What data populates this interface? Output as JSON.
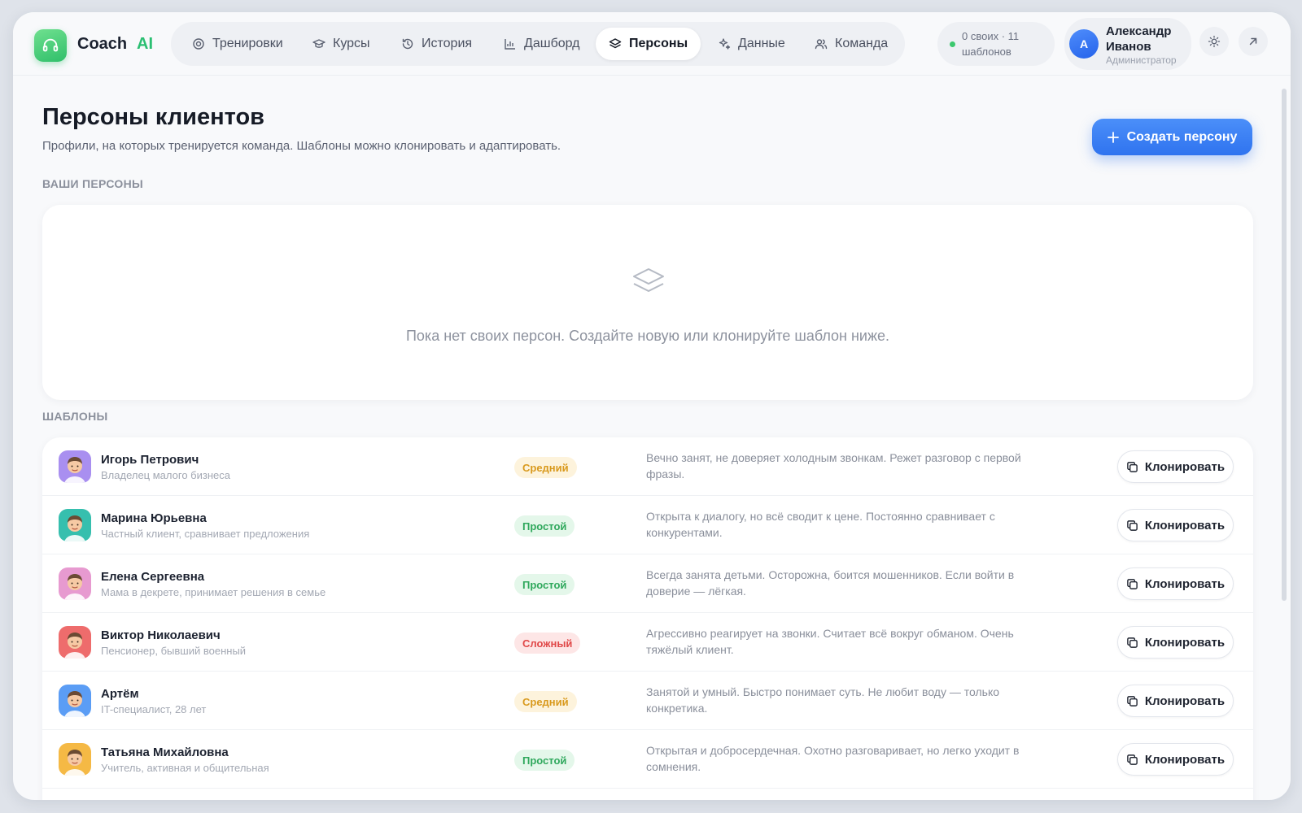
{
  "app": {
    "name": "Coach",
    "name_accent": "AI"
  },
  "nav": [
    {
      "label": "Тренировки",
      "icon": "target-icon",
      "active": false
    },
    {
      "label": "Курсы",
      "icon": "graduation-cap-icon",
      "active": false
    },
    {
      "label": "История",
      "icon": "history-icon",
      "active": false
    },
    {
      "label": "Дашборд",
      "icon": "bar-chart-icon",
      "active": false
    },
    {
      "label": "Персоны",
      "icon": "layers-icon",
      "active": true
    },
    {
      "label": "Данные",
      "icon": "sparkles-icon",
      "active": false
    },
    {
      "label": "Команда",
      "icon": "users-icon",
      "active": false
    }
  ],
  "stats": {
    "text": "0 своих · 11 шаблонов"
  },
  "user": {
    "initial": "А",
    "name": "Александр Иванов",
    "role": "Администратор"
  },
  "page": {
    "title": "Персоны клиентов",
    "subtitle": "Профили, на которых тренируется команда. Шаблоны можно клонировать и адаптировать.",
    "create_button": "Создать персону"
  },
  "sections": {
    "yours_label": "ВАШИ ПЕРСОНЫ",
    "empty_text": "Пока нет своих персон. Создайте новую или клонируйте шаблон ниже.",
    "templates_label": "ШАБЛОНЫ"
  },
  "clone_label": "Клонировать",
  "templates": [
    {
      "name": "Игорь Петрович",
      "role": "Владелец малого бизнеса",
      "level": "Средний",
      "level_kind": "medium",
      "description": "Вечно занят, не доверяет холодным звонкам. Режет разговор с первой фразы.",
      "avatar_bg": "#a98ff0"
    },
    {
      "name": "Марина Юрьевна",
      "role": "Частный клиент, сравнивает предложения",
      "level": "Простой",
      "level_kind": "easy",
      "description": "Открыта к диалогу, но всё сводит к цене. Постоянно сравнивает с конкурентами.",
      "avatar_bg": "#36bfae"
    },
    {
      "name": "Елена Сергеевна",
      "role": "Мама в декрете, принимает решения в семье",
      "level": "Простой",
      "level_kind": "easy",
      "description": "Всегда занята детьми. Осторожна, боится мошенников. Если войти в доверие — лёгкая.",
      "avatar_bg": "#e79ad0"
    },
    {
      "name": "Виктор Николаевич",
      "role": "Пенсионер, бывший военный",
      "level": "Сложный",
      "level_kind": "hard",
      "description": "Агрессивно реагирует на звонки. Считает всё вокруг обманом. Очень тяжёлый клиент.",
      "avatar_bg": "#ee6c6c"
    },
    {
      "name": "Артём",
      "role": "IT-специалист, 28 лет",
      "level": "Средний",
      "level_kind": "medium",
      "description": "Занятой и умный. Быстро понимает суть. Не любит воду — только конкретика.",
      "avatar_bg": "#5b9df5"
    },
    {
      "name": "Татьяна Михайловна",
      "role": "Учитель, активная и общительная",
      "level": "Простой",
      "level_kind": "easy",
      "description": "Открытая и доброcердечная. Охотно разговаривает, но легко уходит в сомнения.",
      "avatar_bg": "#f5b945"
    }
  ],
  "colors": {
    "accent": "#2f73ef",
    "brand_green": "#2bbf72",
    "badge_medium_bg": "#fdf3dc",
    "badge_medium_fg": "#d99a1e",
    "badge_easy_bg": "#e4f7ea",
    "badge_easy_fg": "#2fa85c",
    "badge_hard_bg": "#fde6e6",
    "badge_hard_fg": "#e04848"
  }
}
